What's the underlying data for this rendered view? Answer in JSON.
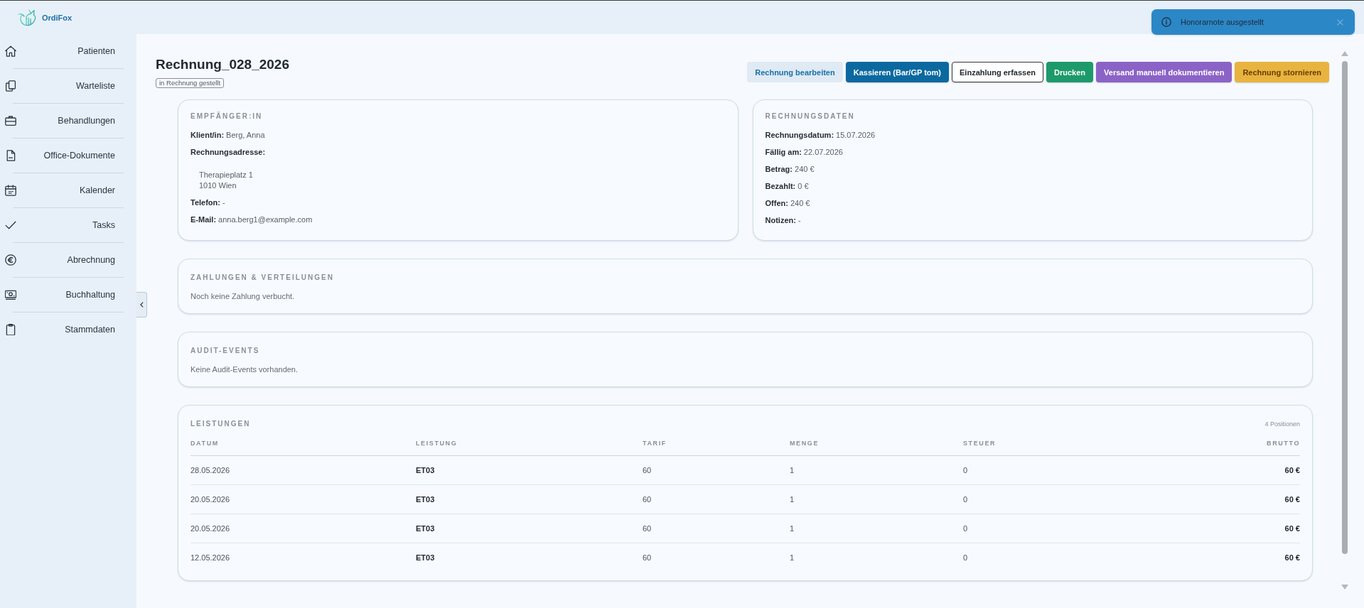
{
  "app": {
    "name": "OrdiFox"
  },
  "sidebar": {
    "items": [
      {
        "label": "Patienten",
        "selected": false
      },
      {
        "label": "Warteliste",
        "selected": false
      },
      {
        "label": "Behandlungen",
        "selected": false
      },
      {
        "label": "Office-Dokumente",
        "selected": false
      },
      {
        "label": "Kalender",
        "selected": false
      },
      {
        "label": "Tasks",
        "selected": false
      },
      {
        "label": "Abrechnung",
        "selected": false
      },
      {
        "label": "Buchhaltung",
        "selected": false
      },
      {
        "label": "Stammdaten",
        "selected": false
      }
    ]
  },
  "toast": {
    "message": "Honorarnote ausgestellt"
  },
  "invoice": {
    "title": "Rechnung_028_2026",
    "status": "in Rechnung gestellt"
  },
  "actions": [
    {
      "label": "Rechnung bearbeiten",
      "kind": "soft"
    },
    {
      "label": "Kassieren (Bar/GP tom)",
      "kind": "primary"
    },
    {
      "label": "Einzahlung erfassen",
      "kind": "outline"
    },
    {
      "label": "Drucken",
      "kind": "success"
    },
    {
      "label": "Versand manuell dokumentieren",
      "kind": "accent"
    },
    {
      "label": "Rechnung stornieren",
      "kind": "warning"
    }
  ],
  "recipient": {
    "heading": "EMPFÄNGER:IN",
    "fields": [
      {
        "kind": "text",
        "label": "Klient/in:",
        "value": "Berg, Anna"
      },
      {
        "kind": "address",
        "label": "Rechnungsadresse:",
        "value": "Therapieplatz 1\n1010 Wien"
      },
      {
        "kind": "text",
        "label": "Telefon:",
        "value": "-"
      },
      {
        "kind": "text",
        "label": "E-Mail:",
        "value": "anna.berg1@example.com"
      }
    ]
  },
  "invoice_data": {
    "heading": "RECHNUNGSDATEN",
    "fields": [
      {
        "kind": "text",
        "label": "Rechnungsdatum:",
        "value": "15.07.2026"
      },
      {
        "kind": "text",
        "label": "Fällig am:",
        "value": "22.07.2026"
      },
      {
        "kind": "text",
        "label": "Betrag:",
        "value": "240 €"
      },
      {
        "kind": "text",
        "label": "Bezahlt:",
        "value": "0 €"
      },
      {
        "kind": "text",
        "label": "Offen:",
        "value": "240 €"
      },
      {
        "kind": "text",
        "label": "Notizen:",
        "value": "-"
      }
    ]
  },
  "payments": {
    "heading": "ZAHLUNGEN & VERTEILUNGEN",
    "empty_text": "Noch keine Zahlung verbucht."
  },
  "audit": {
    "heading": "AUDIT-EVENTS",
    "empty_text": "Keine Audit-Events vorhanden."
  },
  "services": {
    "heading": "LEISTUNGEN",
    "count": "4 Positionen",
    "columns": [
      "DATUM",
      "LEISTUNG",
      "TARIF",
      "MENGE",
      "STEUER",
      "BRUTTO"
    ],
    "rows": [
      [
        "28.05.2026",
        "ET03",
        "60",
        "1",
        "0",
        "60 €"
      ],
      [
        "20.05.2026",
        "ET03",
        "60",
        "1",
        "0",
        "60 €"
      ],
      [
        "20.05.2026",
        "ET03",
        "60",
        "1",
        "0",
        "60 €"
      ],
      [
        "12.05.2026",
        "ET03",
        "60",
        "1",
        "0",
        "60 €"
      ]
    ]
  }
}
